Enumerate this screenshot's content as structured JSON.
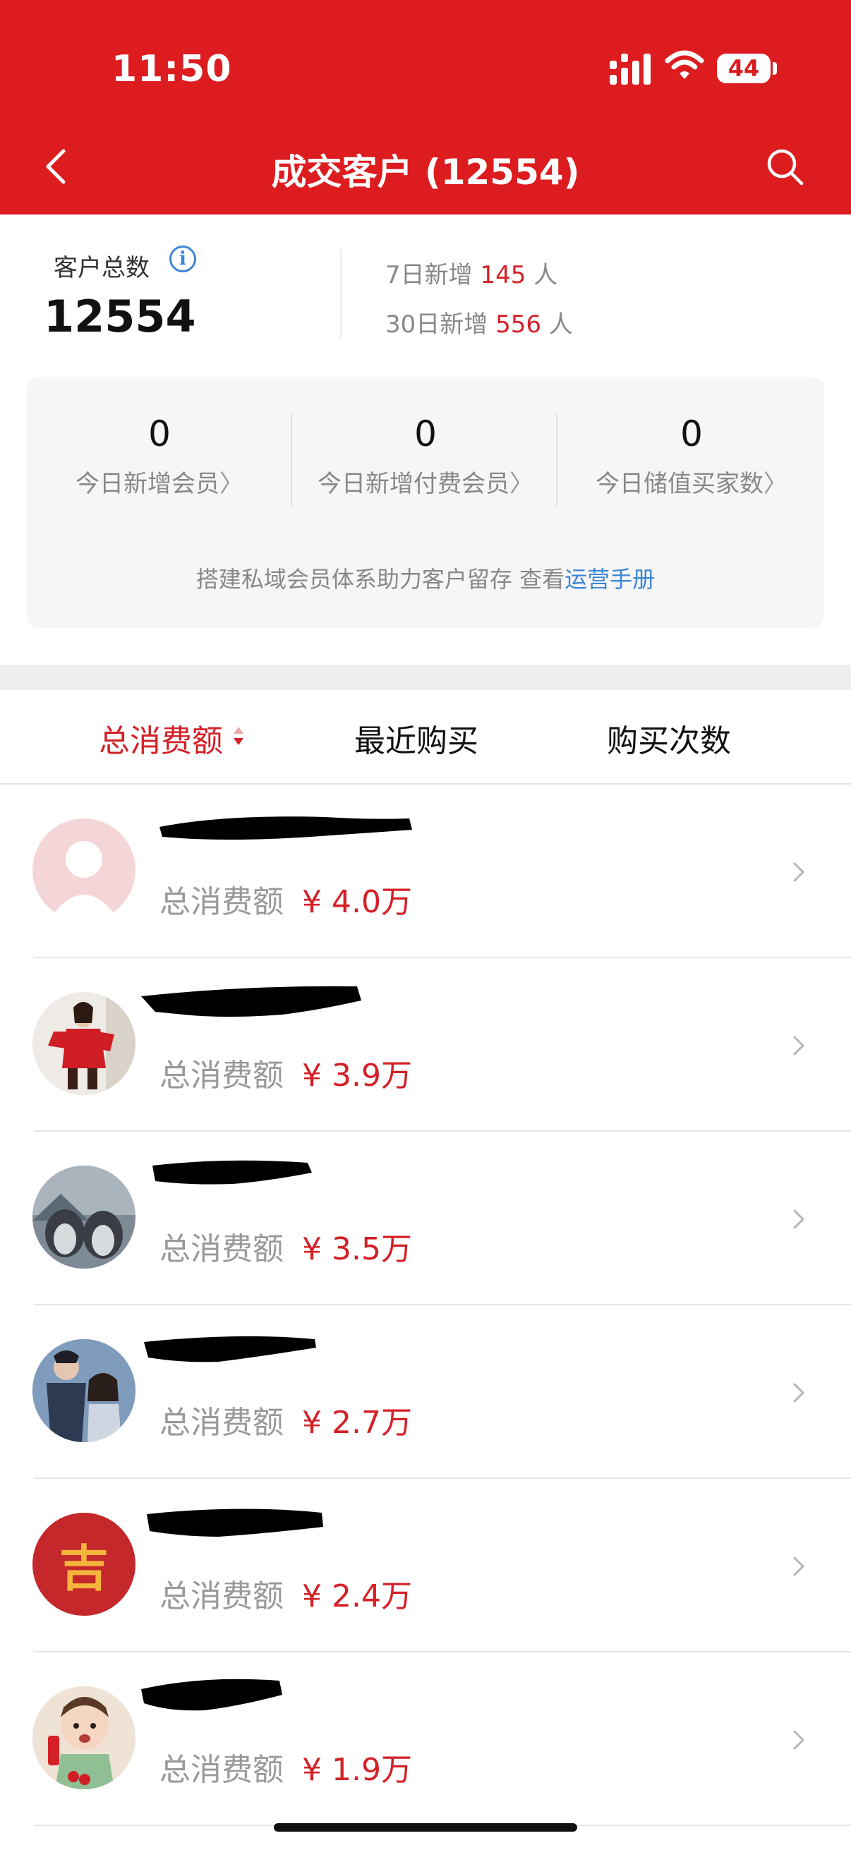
{
  "status_bar": {
    "time": "11:50",
    "battery": "44"
  },
  "header": {
    "title": "成交客户 (12554)"
  },
  "summary": {
    "total_label": "客户总数",
    "total_value": "12554",
    "new7": {
      "prefix": "7日新增",
      "value": "145",
      "suffix": "人"
    },
    "new30": {
      "prefix": "30日新增",
      "value": "556",
      "suffix": "人"
    }
  },
  "member_stats": [
    {
      "value": "0",
      "label": "今日新增会员"
    },
    {
      "value": "0",
      "label": "今日新增付费会员"
    },
    {
      "value": "0",
      "label": "今日储值买家数"
    }
  ],
  "chevron": "〉",
  "member_tip": {
    "text": "搭建私域会员体系助力客户留存 查看",
    "link": "运营手册"
  },
  "sort_tabs": [
    "总消费额",
    "最近购买",
    "购买次数"
  ],
  "customers": [
    {
      "spend_label": "总消费额",
      "spend_value": "¥ 4.0万",
      "avatar": "default-avatar"
    },
    {
      "spend_label": "总消费额",
      "spend_value": "¥ 3.9万",
      "avatar": "red-costume-avatar"
    },
    {
      "spend_label": "总消费额",
      "spend_value": "¥ 3.5万",
      "avatar": "penguins-avatar"
    },
    {
      "spend_label": "总消费额",
      "spend_value": "¥ 2.7万",
      "avatar": "couple-avatar"
    },
    {
      "spend_label": "总消费额",
      "spend_value": "¥ 2.4万",
      "avatar": "ji-character-avatar",
      "avatar_text": "吉"
    },
    {
      "spend_label": "总消费额",
      "spend_value": "¥ 1.9万",
      "avatar": "baby-avatar"
    }
  ],
  "colors": {
    "brand_red": "#dc1c1f",
    "price_red": "#d42027",
    "link_blue": "#3a86d6"
  }
}
